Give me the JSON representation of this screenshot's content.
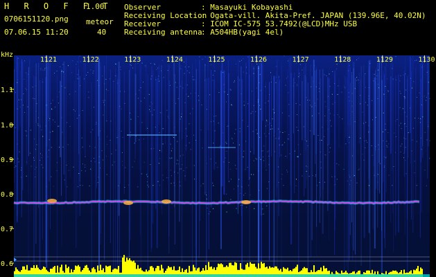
{
  "header": {
    "app_title": "H R O F F T",
    "version": "1.00",
    "filename": "0706151120.png",
    "datetime": "07.06.15 11:20",
    "meteor_label": "meteor",
    "meteor_count": "40",
    "info": [
      {
        "key": "Observer",
        "value": ": Masayuki Kobayashi"
      },
      {
        "key": "Receiving Location",
        "value": ": Ogata-vill. Akita-Pref. JAPAN (139.96E, 40.02N)"
      },
      {
        "key": "Receiver",
        "value": ": ICOM IC-575 53.7492(@LCD)MHz USB"
      },
      {
        "key": "Receiving antenna",
        "value": ": A504HB(yagi 4el)"
      }
    ]
  },
  "spectrogram": {
    "unit_label": "kHz",
    "y_ticks": [
      "1.1",
      "1.0",
      "0.9",
      "0.8",
      "0.7",
      "0.6"
    ],
    "time_ticks": [
      "1121",
      "1122",
      "1123",
      "1124",
      "1125",
      "1126",
      "1127",
      "1128",
      "1129",
      "1130"
    ],
    "colors": {
      "background": "#0a1a8a",
      "signal": "#ff3cff",
      "label": "#ffff3c",
      "level_bar": "#ffff00",
      "level_base": "#00c8c8"
    }
  }
}
